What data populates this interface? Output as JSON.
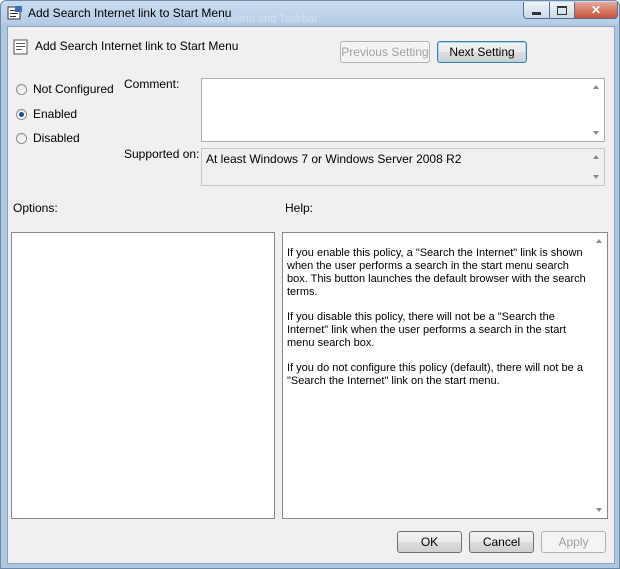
{
  "window": {
    "title": "Add Search Internet link to Start Menu",
    "ghost_title": "Start Menu and Taskbar"
  },
  "header": {
    "setting_name": "Add Search Internet link to Start Menu",
    "previous_label": "Previous Setting",
    "next_label": "Next Setting"
  },
  "state": {
    "options": [
      {
        "label": "Not Configured",
        "checked": false
      },
      {
        "label": "Enabled",
        "checked": true
      },
      {
        "label": "Disabled",
        "checked": false
      }
    ]
  },
  "comment": {
    "label": "Comment:",
    "value": ""
  },
  "supported": {
    "label": "Supported on:",
    "value": "At least Windows 7 or Windows Server 2008 R2"
  },
  "options_label": "Options:",
  "help": {
    "label": "Help:",
    "paragraphs": [
      "If you enable this policy, a \"Search the Internet\" link is shown when the user performs a search in the start menu search box. This button launches the default browser with the search terms.",
      "If you disable this policy, there will not be a \"Search the Internet\" link when the user performs a search in the start menu search box.",
      "If you do not configure this policy (default), there will not be a \"Search the Internet\" link on the start menu."
    ]
  },
  "footer": {
    "ok_label": "OK",
    "cancel_label": "Cancel",
    "apply_label": "Apply"
  },
  "colors": {
    "frame": "#b7cde6",
    "client": "#f0f0f0",
    "radio_dot": "#1b4f8a",
    "close": "#c7503a"
  }
}
